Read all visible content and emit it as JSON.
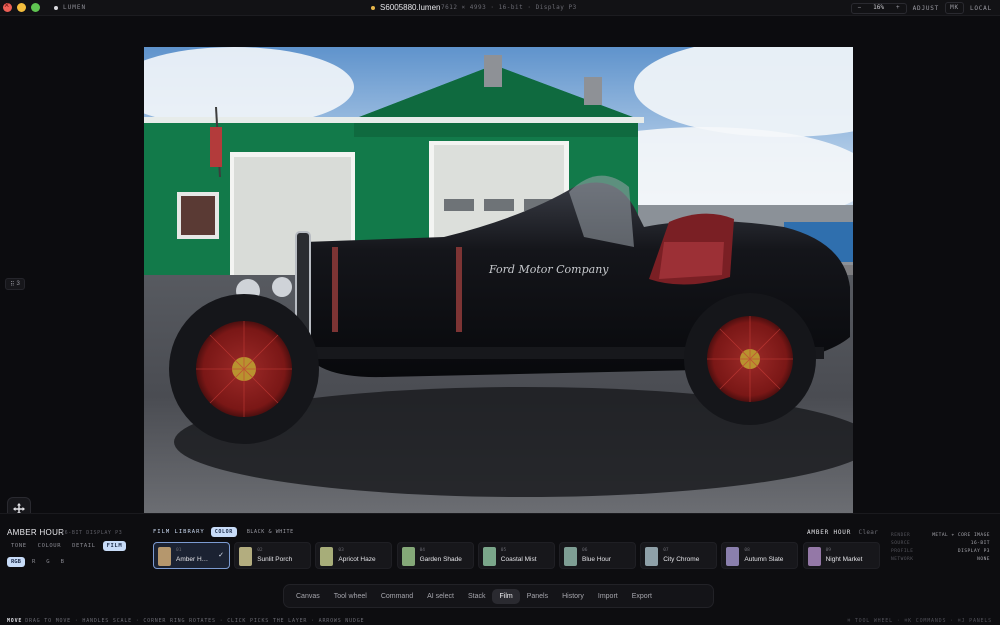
{
  "titlebar": {
    "app_name": "LUMEN",
    "document": "S6005880.lumen",
    "meta": "7612 × 4993 · 16-bit · Display P3",
    "zoom_minus": "−",
    "zoom_value": "16%",
    "zoom_plus": "+",
    "adjust": "ADJUST",
    "mk": "MK",
    "local": "LOCAL"
  },
  "canvas": {
    "layer_count": "3",
    "photo_text": "Ford Motor Company"
  },
  "look": {
    "title": "AMBER HOUR",
    "meta": "16-BIT DISPLAY P3",
    "tabs": [
      {
        "label": "TONE",
        "active": false
      },
      {
        "label": "COLOUR",
        "active": false
      },
      {
        "label": "DETAIL",
        "active": false
      },
      {
        "label": "FILM",
        "active": true
      }
    ],
    "channels": [
      {
        "label": "RGB",
        "active": true
      },
      {
        "label": "R",
        "active": false
      },
      {
        "label": "G",
        "active": false
      },
      {
        "label": "B",
        "active": false
      }
    ]
  },
  "library": {
    "label": "FILM LIBRARY",
    "tab_color": "COLOR",
    "tab_bw": "BLACK & WHITE",
    "selected_label": "AMBER HOUR",
    "clear": "Clear",
    "presets": [
      {
        "num": "01",
        "name": "Amber H…",
        "color": "#b5976d",
        "selected": true
      },
      {
        "num": "02",
        "name": "Sunlit Porch",
        "color": "#b3ad7f",
        "selected": false
      },
      {
        "num": "03",
        "name": "Apricot Haze",
        "color": "#a7ad79",
        "selected": false
      },
      {
        "num": "04",
        "name": "Garden Shade",
        "color": "#84a878",
        "selected": false
      },
      {
        "num": "05",
        "name": "Coastal Mist",
        "color": "#7aa68a",
        "selected": false
      },
      {
        "num": "06",
        "name": "Blue Hour",
        "color": "#7e9e94",
        "selected": false
      },
      {
        "num": "07",
        "name": "City Chrome",
        "color": "#8ea0a8",
        "selected": false
      },
      {
        "num": "08",
        "name": "Autumn Slate",
        "color": "#8a7fad",
        "selected": false
      },
      {
        "num": "09",
        "name": "Night Market",
        "color": "#9478a7",
        "selected": false
      }
    ]
  },
  "render": {
    "rows": [
      {
        "key": "RENDER",
        "value": "METAL + CORE IMAGE"
      },
      {
        "key": "SOURCE",
        "value": "16-BIT"
      },
      {
        "key": "PROFILE",
        "value": "DISPLAY P3"
      },
      {
        "key": "NETWORK",
        "value": "NONE"
      }
    ]
  },
  "dock": {
    "items": [
      {
        "label": "Canvas",
        "active": false
      },
      {
        "label": "Tool wheel",
        "active": false
      },
      {
        "label": "Command",
        "active": false
      },
      {
        "label": "AI select",
        "active": false
      },
      {
        "label": "Stack",
        "active": false
      },
      {
        "label": "Film",
        "active": true
      },
      {
        "label": "Panels",
        "active": false
      },
      {
        "label": "History",
        "active": false
      },
      {
        "label": "Import",
        "active": false
      },
      {
        "label": "Export",
        "active": false
      }
    ]
  },
  "footer": {
    "mode": "MOVE",
    "hints": "DRAG TO MOVE · HANDLES SCALE · CORNER RING ROTATES · CLICK PICKS THE LAYER · ARROWS NUDGE",
    "shortcuts": "⌘ TOOL WHEEL · ⌘K COMMANDS · ⌘J PANELS"
  }
}
